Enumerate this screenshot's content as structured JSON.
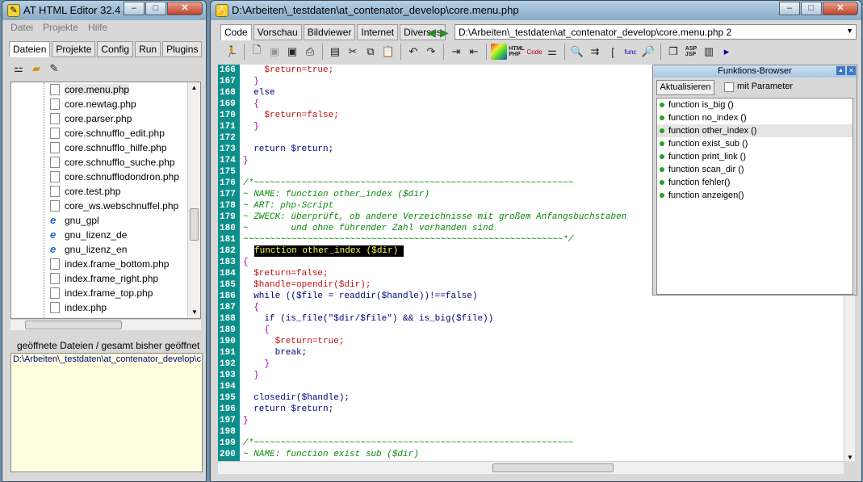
{
  "left_window": {
    "title": "AT HTML Editor 32.4",
    "menu": [
      "Datei",
      "Projekte",
      "Hilfe"
    ],
    "tabs": [
      "Dateien",
      "Projekte",
      "Config",
      "Run",
      "Plugins"
    ],
    "files": [
      {
        "name": "core.menu.php",
        "icon": "php-file-icon",
        "selected": true
      },
      {
        "name": "core.newtag.php",
        "icon": "php-file-icon"
      },
      {
        "name": "core.parser.php",
        "icon": "php-file-icon"
      },
      {
        "name": "core.schnufflo_edit.php",
        "icon": "php-file-icon"
      },
      {
        "name": "core.schnufflo_hilfe.php",
        "icon": "php-file-icon"
      },
      {
        "name": "core.schnufflo_suche.php",
        "icon": "php-file-icon"
      },
      {
        "name": "core.schnufflodondron.php",
        "icon": "php-file-icon"
      },
      {
        "name": "core.test.php",
        "icon": "php-file-icon"
      },
      {
        "name": "core_ws.webschnuffel.php",
        "icon": "php-file-icon"
      },
      {
        "name": "gnu_gpl",
        "icon": "ie-file-icon"
      },
      {
        "name": "gnu_lizenz_de",
        "icon": "ie-file-icon"
      },
      {
        "name": "gnu_lizenz_en",
        "icon": "ie-file-icon"
      },
      {
        "name": "index.frame_bottom.php",
        "icon": "php-file-icon"
      },
      {
        "name": "index.frame_right.php",
        "icon": "php-file-icon"
      },
      {
        "name": "index.frame_top.php",
        "icon": "php-file-icon"
      },
      {
        "name": "index.php",
        "icon": "php-file-icon"
      }
    ],
    "opened_label": "geöffnete Dateien / gesamt bisher geöffnet",
    "opened_path": "D:\\Arbeiten\\_testdaten\\at_contenator_develop\\c"
  },
  "editor_window": {
    "title": "D:\\Arbeiten\\_testdaten\\at_contenator_develop\\core.menu.php",
    "tabs": [
      "Code",
      "Vorschau",
      "Bildviewer",
      "Internet",
      "Diverses"
    ],
    "path_select": "D:\\Arbeiten\\_testdaten\\at_contenator_develop\\core.menu.php 2",
    "code_lines": [
      {
        "n": "166",
        "t": "    $return=true;",
        "c": "var"
      },
      {
        "n": "167",
        "t": "  }",
        "c": "br"
      },
      {
        "n": "168",
        "t": "  else",
        "c": "kw"
      },
      {
        "n": "169",
        "t": "  {",
        "c": "br"
      },
      {
        "n": "170",
        "t": "    $return=false;",
        "c": "var"
      },
      {
        "n": "171",
        "t": "  }",
        "c": "br"
      },
      {
        "n": "172",
        "t": "",
        "c": "pl"
      },
      {
        "n": "173",
        "t": "  return $return;",
        "c": "kw"
      },
      {
        "n": "174",
        "t": "}",
        "c": "br"
      },
      {
        "n": "175",
        "t": "",
        "c": "pl"
      },
      {
        "n": "176",
        "t": "/*~~~~~~~~~~~~~~~~~~~~~~~~~~~~~~~~~~~~~~~~~~~~~~~~~~~~~~~~~~~~",
        "c": "cm"
      },
      {
        "n": "177",
        "t": "~ NAME: function other_index ($dir)",
        "c": "cm"
      },
      {
        "n": "178",
        "t": "~ ART: php-Script",
        "c": "cm"
      },
      {
        "n": "179",
        "t": "~ ZWECK: überprüft, ob andere Verzeichnisse mit großem Anfangsbuchstaben",
        "c": "cm"
      },
      {
        "n": "180",
        "t": "~        und ohne führender Zahl vorhanden sind",
        "c": "cm"
      },
      {
        "n": "181",
        "t": "~~~~~~~~~~~~~~~~~~~~~~~~~~~~~~~~~~~~~~~~~~~~~~~~~~~~~~~~~~~~*/",
        "c": "cm"
      },
      {
        "n": "182",
        "t": "function other_index ($dir) ",
        "c": "hl"
      },
      {
        "n": "183",
        "t": "{",
        "c": "br"
      },
      {
        "n": "184",
        "t": "  $return=false;",
        "c": "var"
      },
      {
        "n": "185",
        "t": "  $handle=opendir($dir);",
        "c": "var"
      },
      {
        "n": "186",
        "t": "  while (($file = readdir($handle))!==false)",
        "c": "kw"
      },
      {
        "n": "187",
        "t": "  {",
        "c": "br"
      },
      {
        "n": "188",
        "t": "    if (is_file(\"$dir/$file\") && is_big($file))",
        "c": "kw"
      },
      {
        "n": "189",
        "t": "    {",
        "c": "br"
      },
      {
        "n": "190",
        "t": "      $return=true;",
        "c": "var"
      },
      {
        "n": "191",
        "t": "      break;",
        "c": "kw"
      },
      {
        "n": "192",
        "t": "    }",
        "c": "br"
      },
      {
        "n": "193",
        "t": "  }",
        "c": "br"
      },
      {
        "n": "194",
        "t": "",
        "c": "pl"
      },
      {
        "n": "195",
        "t": "  closedir($handle);",
        "c": "kw"
      },
      {
        "n": "196",
        "t": "  return $return;",
        "c": "kw"
      },
      {
        "n": "197",
        "t": "}",
        "c": "br"
      },
      {
        "n": "198",
        "t": "",
        "c": "pl"
      },
      {
        "n": "199",
        "t": "/*~~~~~~~~~~~~~~~~~~~~~~~~~~~~~~~~~~~~~~~~~~~~~~~~~~~~~~~~~~~~",
        "c": "cm"
      },
      {
        "n": "200",
        "t": "~ NAME: function exist sub ($dir)",
        "c": "cm"
      }
    ],
    "func_browser": {
      "title": "Funktions-Browser",
      "refresh_label": "Aktualisieren",
      "param_label": "mit Parameter",
      "functions": [
        "function is_big ()",
        "function no_index ()",
        "function other_index ()",
        "function exist_sub ()",
        "function print_link ()",
        "function scan_dir ()",
        "function fehler()",
        "function anzeigen()"
      ],
      "selected_index": 2
    }
  }
}
